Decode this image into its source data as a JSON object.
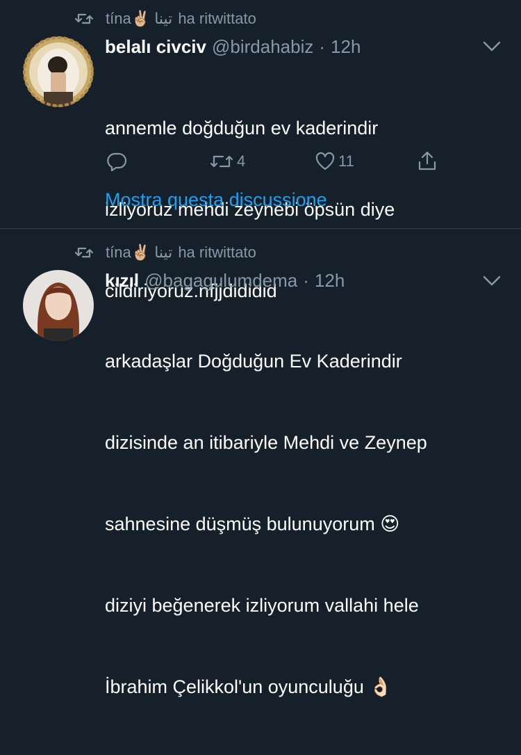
{
  "tweets": [
    {
      "retweeter": "tína✌🏼 تينا",
      "retweet_suffix": "ha ritwittato",
      "name": "belalı civciv",
      "handle": "@birdahabiz",
      "dot": "·",
      "time": "12h",
      "lines": [
        "annemle doğduğun ev kaderindir",
        "izliyoruz mehdi zeynebi öpsün diye",
        "cildiriyoruz.nfjjdididid"
      ],
      "retweets": "4",
      "likes": "11",
      "show_thread": "Mostra questa discussione"
    },
    {
      "retweeter": "tína✌🏼 تينا",
      "retweet_suffix": "ha ritwittato",
      "name": "kızıl",
      "handle": "@bagagulumdema",
      "dot": "·",
      "time": "12h",
      "lines": [
        "arkadaşlar Doğduğun Ev Kaderindir",
        "dizisinde an itibariyle Mehdi ve Zeynep",
        "sahnesine düşmüş bulunuyorum 😍",
        "diziyi beğenerek izliyorum vallahi hele",
        "İbrahim Çelikkol'un oyunculuğu 👌🏻"
      ]
    }
  ],
  "colors": {
    "background": "#15202b",
    "secondary_text": "#8899a6",
    "link": "#1da1f2",
    "divider": "#38444d"
  }
}
